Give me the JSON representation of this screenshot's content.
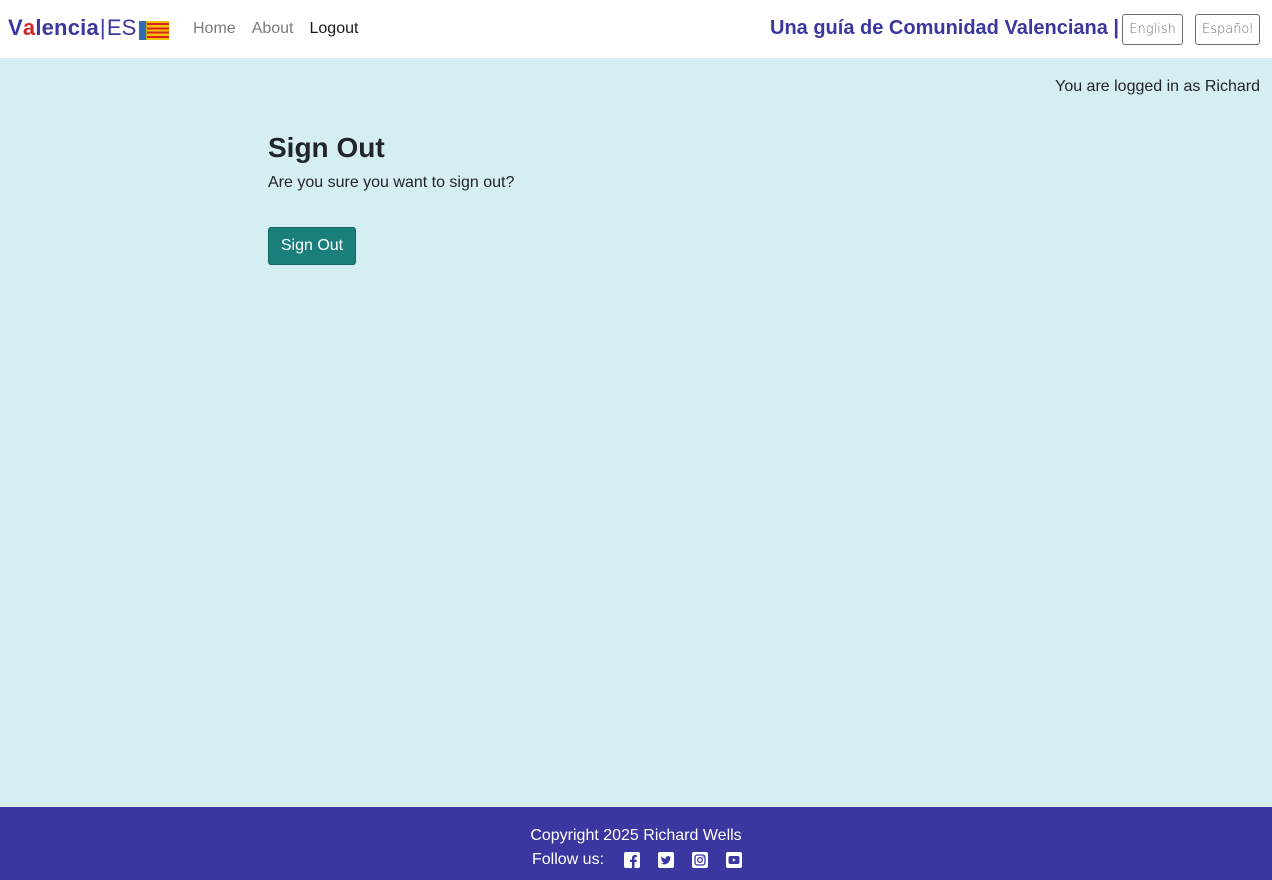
{
  "nav": {
    "brand": {
      "part1": "V",
      "part2": "a",
      "part3": "lencia",
      "separator": "|",
      "suffix": "ES"
    },
    "flag_icon": "valencia-flag-icon",
    "links": [
      {
        "label": "Home"
      },
      {
        "label": "About"
      },
      {
        "label": "Logout"
      }
    ],
    "tagline": "Una guía de Comunidad Valenciana  |",
    "lang_buttons": {
      "english": "English",
      "spanish": "Español"
    }
  },
  "status": {
    "logged_in_text": "You are logged in as Richard"
  },
  "main": {
    "title": "Sign Out",
    "prompt": "Are you sure you want to sign out?",
    "button_label": "Sign Out"
  },
  "footer": {
    "copyright": "Copyright 2025 Richard Wells",
    "follow_label": "Follow us:",
    "social_icons": [
      "facebook-icon",
      "twitter-icon",
      "instagram-icon",
      "youtube-icon"
    ]
  },
  "colors": {
    "brand_blue": "#3a37a0",
    "brand_red": "#d32a2a",
    "page_bg": "#d4eef1",
    "button_teal": "#1a7f7a"
  }
}
